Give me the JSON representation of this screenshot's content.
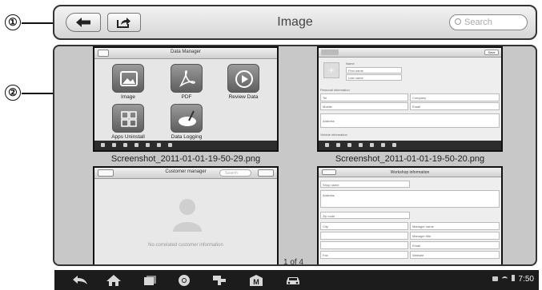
{
  "callouts": [
    "①",
    "②"
  ],
  "header": {
    "title": "Image",
    "search_placeholder": "Search"
  },
  "thumbnails": [
    {
      "caption": "Screenshot_2011-01-01-19-50-29.png",
      "screen_title": "Data Manager",
      "apps": [
        "Image",
        "PDF",
        "Review Data",
        "Apps Uninstall",
        "Data Logging"
      ]
    },
    {
      "caption": "Screenshot_2011-01-01-19-50-20.png",
      "screen_title": "",
      "save_label": "Save",
      "sections": [
        "Personal information",
        "Vehicle information"
      ],
      "fields": [
        "Name",
        "First name",
        "Last name",
        "Tel",
        "Mobile",
        "Address",
        "Company",
        "Email"
      ]
    },
    {
      "caption": "",
      "screen_title": "Customer manager",
      "search_placeholder": "Search",
      "empty_text": "No correlated customer information"
    },
    {
      "caption": "",
      "screen_title": "Workshop information",
      "fields": [
        "Shop name",
        "Address",
        "Zip code",
        "City",
        "Manager name",
        "Manager title",
        "Email",
        "Fax",
        "Website"
      ]
    }
  ],
  "pagination": "1 of 4",
  "status_bar": {
    "time": "7:50"
  },
  "nav_icons": [
    "back-icon",
    "home-icon",
    "recents-icon",
    "chrome-icon",
    "vci-icon",
    "maxifix-icon",
    "car-icon"
  ]
}
